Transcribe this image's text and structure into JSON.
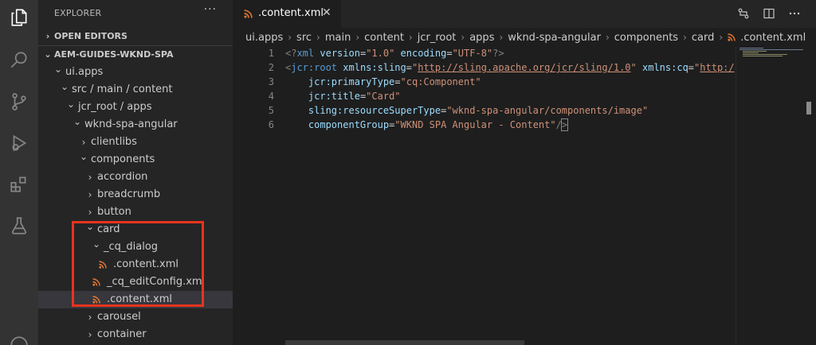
{
  "sidebar": {
    "title": "EXPLORER",
    "more": "···",
    "open_editors": "OPEN EDITORS",
    "workspace": "AEM-GUIDES-WKND-SPA",
    "tree": [
      {
        "label": "ui.apps",
        "indent": 0,
        "chev": "v",
        "icon": "none"
      },
      {
        "label": "src / main / content",
        "indent": 1,
        "chev": "v",
        "icon": "none"
      },
      {
        "label": "jcr_root / apps",
        "indent": 2,
        "chev": "v",
        "icon": "none"
      },
      {
        "label": "wknd-spa-angular",
        "indent": 3,
        "chev": "v",
        "icon": "none"
      },
      {
        "label": "clientlibs",
        "indent": 4,
        "chev": ">",
        "icon": "none"
      },
      {
        "label": "components",
        "indent": 4,
        "chev": "v",
        "icon": "none"
      },
      {
        "label": "accordion",
        "indent": 5,
        "chev": ">",
        "icon": "none"
      },
      {
        "label": "breadcrumb",
        "indent": 5,
        "chev": ">",
        "icon": "none"
      },
      {
        "label": "button",
        "indent": 5,
        "chev": ">",
        "icon": "none"
      },
      {
        "label": "card",
        "indent": 5,
        "chev": "v",
        "icon": "none"
      },
      {
        "label": "_cq_dialog",
        "indent": 6,
        "chev": "v",
        "icon": "none"
      },
      {
        "label": ".content.xml",
        "indent": 7,
        "chev": "",
        "icon": "rss"
      },
      {
        "label": "_cq_editConfig.xml",
        "indent": 6,
        "chev": "",
        "icon": "rss"
      },
      {
        "label": ".content.xml",
        "indent": 6,
        "chev": "",
        "icon": "rss",
        "selected": true
      },
      {
        "label": "carousel",
        "indent": 5,
        "chev": ">",
        "icon": "none"
      },
      {
        "label": "container",
        "indent": 5,
        "chev": ">",
        "icon": "none"
      }
    ]
  },
  "tab": {
    "label": ".content.xml",
    "close": "✕"
  },
  "breadcrumb": [
    "ui.apps",
    "src",
    "main",
    "content",
    "jcr_root",
    "apps",
    "wknd-spa-angular",
    "components",
    "card",
    ".content.xml"
  ],
  "editor": {
    "line_numbers": [
      "1",
      "2",
      "3",
      "4",
      "5",
      "6"
    ],
    "lines": [
      [
        [
          "t-punc",
          "<?"
        ],
        [
          "t-tag",
          "xml"
        ],
        [
          "t-eq",
          " "
        ],
        [
          "t-attr",
          "version"
        ],
        [
          "t-eq",
          "="
        ],
        [
          "t-str",
          "\"1.0\""
        ],
        [
          "t-eq",
          " "
        ],
        [
          "t-attr",
          "encoding"
        ],
        [
          "t-eq",
          "="
        ],
        [
          "t-str",
          "\"UTF-8\""
        ],
        [
          "t-punc",
          "?>"
        ]
      ],
      [
        [
          "t-punc",
          "<"
        ],
        [
          "t-tag",
          "jcr:root"
        ],
        [
          "t-eq",
          " "
        ],
        [
          "t-attr",
          "xmlns:sling"
        ],
        [
          "t-eq",
          "="
        ],
        [
          "t-str",
          "\""
        ],
        [
          "t-link",
          "http://sling.apache.org/jcr/sling/1.0"
        ],
        [
          "t-str",
          "\""
        ],
        [
          "t-eq",
          " "
        ],
        [
          "t-attr",
          "xmlns:cq"
        ],
        [
          "t-eq",
          "="
        ],
        [
          "t-str",
          "\""
        ],
        [
          "t-link",
          "http:/"
        ]
      ],
      [
        [
          "t-eq",
          "    "
        ],
        [
          "t-attr",
          "jcr:primaryType"
        ],
        [
          "t-eq",
          "="
        ],
        [
          "t-str",
          "\"cq:Component\""
        ]
      ],
      [
        [
          "t-eq",
          "    "
        ],
        [
          "t-attr",
          "jcr:title"
        ],
        [
          "t-eq",
          "="
        ],
        [
          "t-str",
          "\"Card\""
        ]
      ],
      [
        [
          "t-eq",
          "    "
        ],
        [
          "t-attr",
          "sling:resourceSuperType"
        ],
        [
          "t-eq",
          "="
        ],
        [
          "t-str",
          "\"wknd-spa-angular/components/image\""
        ]
      ],
      [
        [
          "t-eq",
          "    "
        ],
        [
          "t-attr",
          "componentGroup"
        ],
        [
          "t-eq",
          "="
        ],
        [
          "t-str",
          "\"WKND SPA Angular - Content\""
        ],
        [
          "t-punc",
          "/"
        ],
        [
          "t-punc cursor-box",
          ">"
        ]
      ]
    ]
  },
  "colors": {
    "accent_highlight": "#e8331e",
    "rss_icon": "#e37933"
  }
}
